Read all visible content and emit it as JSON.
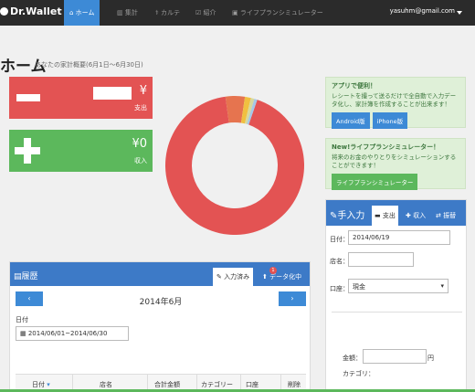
{
  "nav": {
    "logo": "Dr.Wallet",
    "tabs": [
      "ホーム",
      "集計",
      "カルテ",
      "紹介",
      "ライフプランシミュレーター"
    ],
    "email": "yasuhm@gmail.com"
  },
  "header": {
    "title": "ホーム",
    "subtitle": "あなたの家計概要(6月1日〜6月30日)"
  },
  "expense_card": {
    "amount": "¥",
    "label": "支出"
  },
  "income_card": {
    "amount": "¥0",
    "label": "収入"
  },
  "chart_data": {
    "type": "pie",
    "categories": [
      "",
      "",
      "",
      "",
      ""
    ],
    "values": [
      92.6,
      4.5,
      1.4,
      0.8,
      0.7
    ],
    "colors": [
      "#e35353",
      "#e6744f",
      "#f0c040",
      "#d9d99b",
      "#a6c8e8"
    ]
  },
  "app_promo": {
    "title": "アプリで便利！",
    "text": "レシートを撮って送るだけで全自動で入力データ化し、家計簿を作成することが出来ます！",
    "android": "Android版",
    "iphone": "iPhone版"
  },
  "life_promo": {
    "title": "New!ライフプランシミュレーター！",
    "text": "将来のお金のやりとりをシミュレーションすることができます！",
    "button": "ライフプランシミュレーター"
  },
  "entry": {
    "title": "手入力",
    "tabs": [
      "支出",
      "収入",
      "振替"
    ],
    "date_label": "日付：",
    "date_value": "2014/06/19",
    "store_label": "店名：",
    "account_label": "口座：",
    "account_value": "現金",
    "amount_label": "金額：",
    "amount_unit": "円",
    "category_label": "カテゴリ："
  },
  "history": {
    "title": "履歴",
    "tab_done": "入力済み",
    "tab_pending": "データ化中",
    "badge": "1",
    "month": "2014年6月",
    "date_label": "日付",
    "range": "2014/06/01~2014/06/30",
    "columns": [
      "日付",
      "店名",
      "合計金額",
      "カテゴリー",
      "口座",
      "削除"
    ]
  }
}
